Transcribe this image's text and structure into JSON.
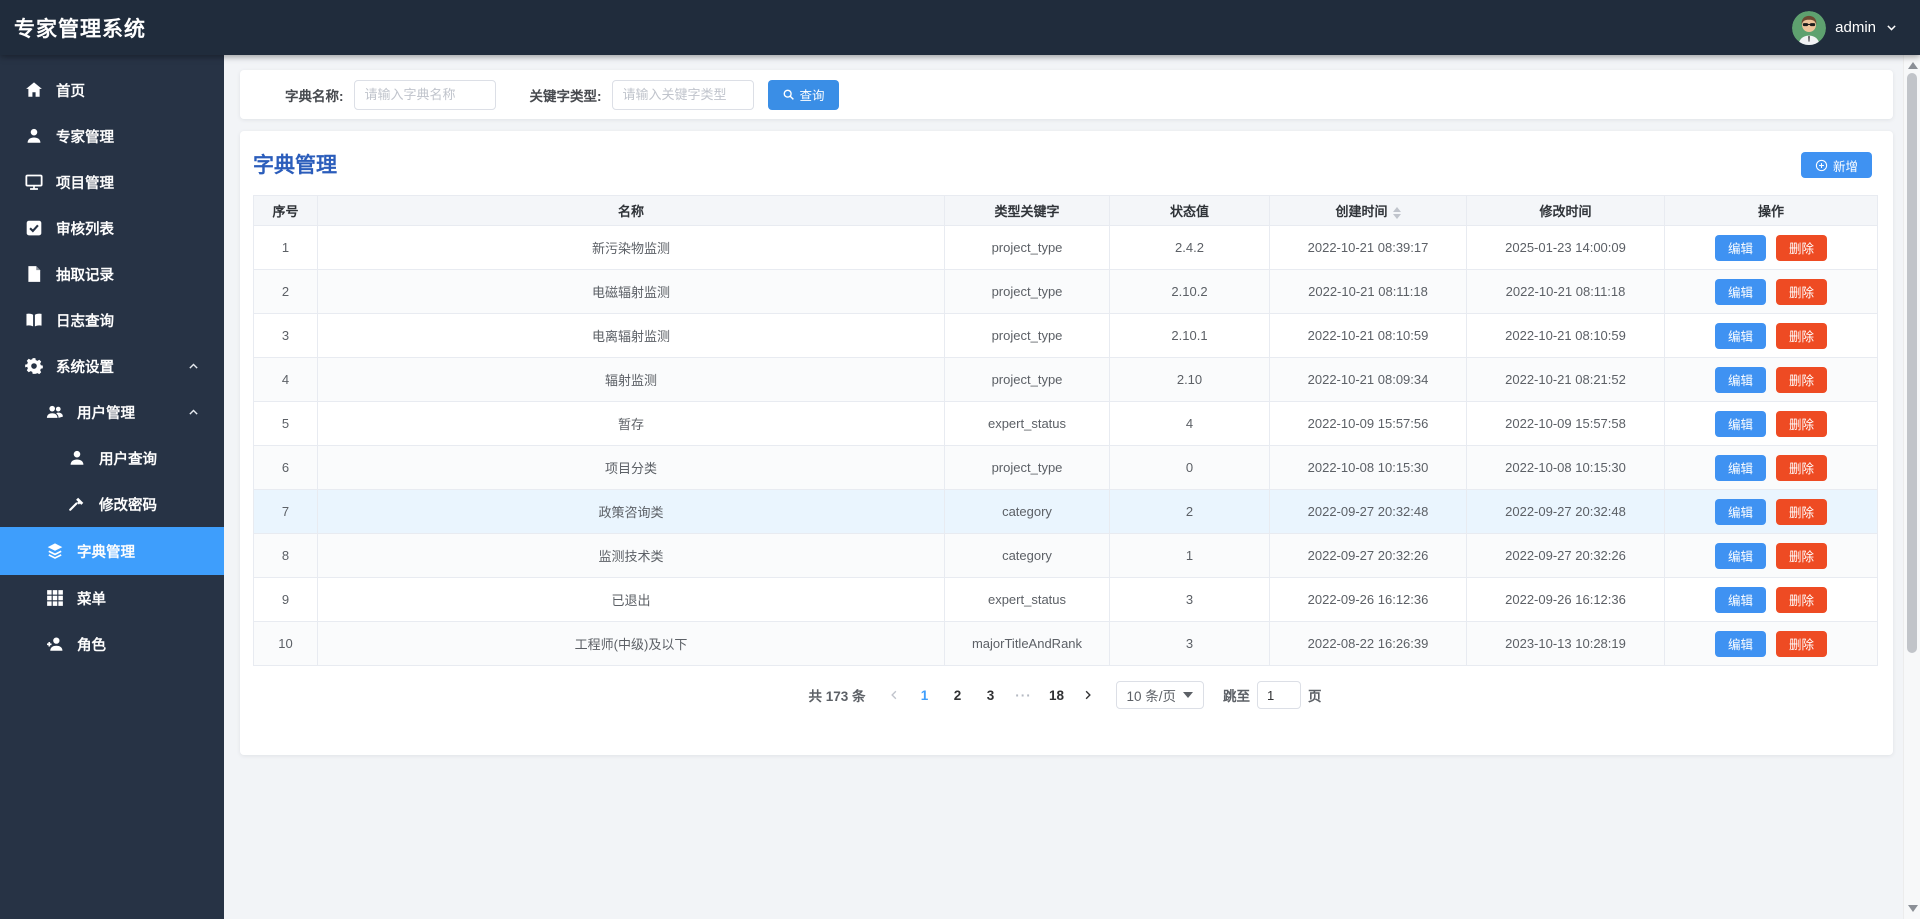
{
  "app": {
    "title": "专家管理系统",
    "user": "admin"
  },
  "sidebar": {
    "items": [
      {
        "label": "首页",
        "icon": "home-icon",
        "level": 1
      },
      {
        "label": "专家管理",
        "icon": "user-icon",
        "level": 1
      },
      {
        "label": "项目管理",
        "icon": "monitor-icon",
        "level": 1
      },
      {
        "label": "审核列表",
        "icon": "audit-icon",
        "level": 1
      },
      {
        "label": "抽取记录",
        "icon": "file-icon",
        "level": 1
      },
      {
        "label": "日志查询",
        "icon": "book-icon",
        "level": 1
      },
      {
        "label": "系统设置",
        "icon": "gear-icon",
        "level": 1,
        "expanded": true
      },
      {
        "label": "用户管理",
        "icon": "users-icon",
        "level": 2,
        "expanded": true
      },
      {
        "label": "用户查询",
        "icon": "user-icon",
        "level": 3
      },
      {
        "label": "修改密码",
        "icon": "wrench-icon",
        "level": 3
      },
      {
        "label": "字典管理",
        "icon": "layers-icon",
        "level": 2,
        "active": true
      },
      {
        "label": "菜单",
        "icon": "grid-icon",
        "level": 2
      },
      {
        "label": "角色",
        "icon": "user-plus-icon",
        "level": 2
      }
    ]
  },
  "search": {
    "name_label": "字典名称:",
    "name_placeholder": "请输入字典名称",
    "type_label": "关键字类型:",
    "type_placeholder": "请输入关键字类型",
    "submit_label": "查询"
  },
  "page": {
    "title": "字典管理",
    "add_label": "新增"
  },
  "table": {
    "headers": [
      "序号",
      "名称",
      "类型关键字",
      "状态值",
      "创建时间",
      "修改时间",
      "操作"
    ],
    "sortable_header": "创建时间",
    "edit_label": "编辑",
    "delete_label": "删除",
    "rows": [
      {
        "no": "1",
        "name": "新污染物监测",
        "type": "project_type",
        "status": "2.4.2",
        "created": "2022-10-21 08:39:17",
        "modified": "2025-01-23 14:00:09"
      },
      {
        "no": "2",
        "name": "电磁辐射监测",
        "type": "project_type",
        "status": "2.10.2",
        "created": "2022-10-21 08:11:18",
        "modified": "2022-10-21 08:11:18"
      },
      {
        "no": "3",
        "name": "电离辐射监测",
        "type": "project_type",
        "status": "2.10.1",
        "created": "2022-10-21 08:10:59",
        "modified": "2022-10-21 08:10:59"
      },
      {
        "no": "4",
        "name": "辐射监测",
        "type": "project_type",
        "status": "2.10",
        "created": "2022-10-21 08:09:34",
        "modified": "2022-10-21 08:21:52"
      },
      {
        "no": "5",
        "name": "暂存",
        "type": "expert_status",
        "status": "4",
        "created": "2022-10-09 15:57:56",
        "modified": "2022-10-09 15:57:58"
      },
      {
        "no": "6",
        "name": "项目分类",
        "type": "project_type",
        "status": "0",
        "created": "2022-10-08 10:15:30",
        "modified": "2022-10-08 10:15:30"
      },
      {
        "no": "7",
        "name": "政策咨询类",
        "type": "category",
        "status": "2",
        "created": "2022-09-27 20:32:48",
        "modified": "2022-09-27 20:32:48",
        "highlighted": true
      },
      {
        "no": "8",
        "name": "监测技术类",
        "type": "category",
        "status": "1",
        "created": "2022-09-27 20:32:26",
        "modified": "2022-09-27 20:32:26"
      },
      {
        "no": "9",
        "name": "已退出",
        "type": "expert_status",
        "status": "3",
        "created": "2022-09-26 16:12:36",
        "modified": "2022-09-26 16:12:36"
      },
      {
        "no": "10",
        "name": "工程师(中级)及以下",
        "type": "majorTitleAndRank",
        "status": "3",
        "created": "2022-08-22 16:26:39",
        "modified": "2023-10-13 10:28:19"
      }
    ]
  },
  "pagination": {
    "total": "共 173 条",
    "pages": [
      "1",
      "2",
      "3",
      "···",
      "18"
    ],
    "active_page": "1",
    "page_size": "10 条/页",
    "jump_label": "跳至",
    "jump_value": "1",
    "jump_suffix": "页"
  },
  "colors": {
    "header_bg": "#202c3c",
    "sidebar_bg": "#273345",
    "active_item": "#3e9efc",
    "primary_button": "#3f92f2",
    "danger_button": "#ee4b23",
    "title_blue": "#2b5dbb",
    "avatar_green": "#5ea16f"
  }
}
